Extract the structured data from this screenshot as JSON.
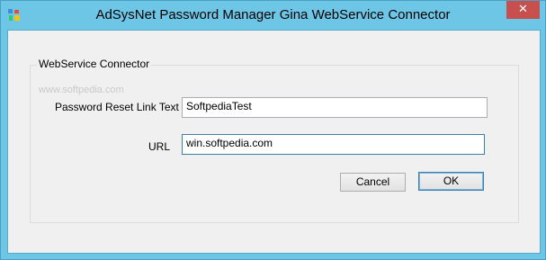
{
  "window": {
    "title": "AdSysNet Password Manager Gina WebService Connector",
    "close_glyph": "✕"
  },
  "group": {
    "title": "WebService Connector",
    "watermark": "www.softpedia.com"
  },
  "form": {
    "reset_label": "Password Reset Link Text",
    "reset_value": "SoftpediaTest",
    "url_label": "URL",
    "url_value": "win.softpedia.com"
  },
  "buttons": {
    "cancel": "Cancel",
    "ok": "OK"
  },
  "icons": {
    "app": "app-logo-icon",
    "close": "close-icon"
  }
}
